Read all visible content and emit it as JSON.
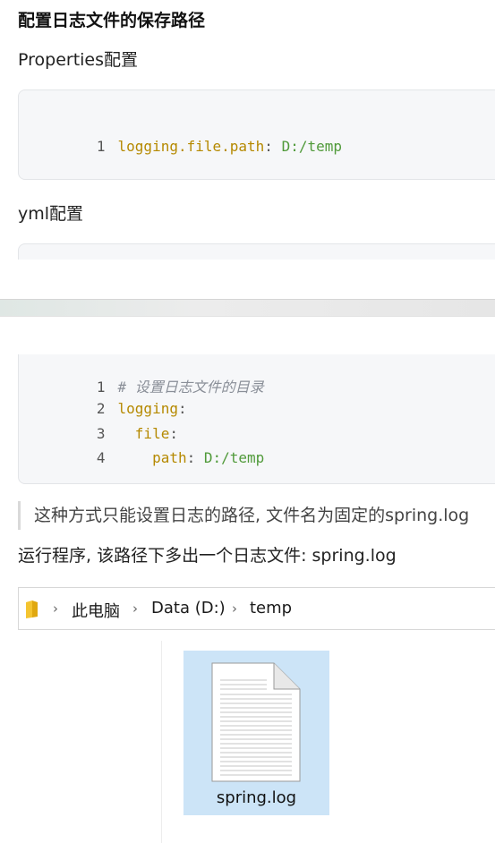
{
  "heading": "配置日志文件的保存路径",
  "properties_label": "Properties配置",
  "properties_code": {
    "line_no": "1",
    "key": "logging.file.path",
    "sep": ":",
    "value": "D:/temp"
  },
  "yml_label": "yml配置",
  "yml_code": [
    {
      "no": "1",
      "comment": "# 设置日志文件的目录"
    },
    {
      "no": "2",
      "key": "logging",
      "sep": ":"
    },
    {
      "no": "3",
      "indent": "  ",
      "key": "file",
      "sep": ":"
    },
    {
      "no": "4",
      "indent": "    ",
      "key": "path",
      "sep": ":",
      "value": "D:/temp"
    }
  ],
  "note": "这种方式只能设置日志的路径, 文件名为固定的spring.log",
  "run_text": "运行程序, 该路径下多出一个日志文件: spring.log",
  "explorer": {
    "breadcrumb": [
      "此电脑",
      "Data (D:)",
      "temp"
    ],
    "file_name": "spring.log",
    "icons": {
      "folder": "folder-icon",
      "chevron": "chevron-right-icon",
      "file": "text-file-icon"
    }
  }
}
